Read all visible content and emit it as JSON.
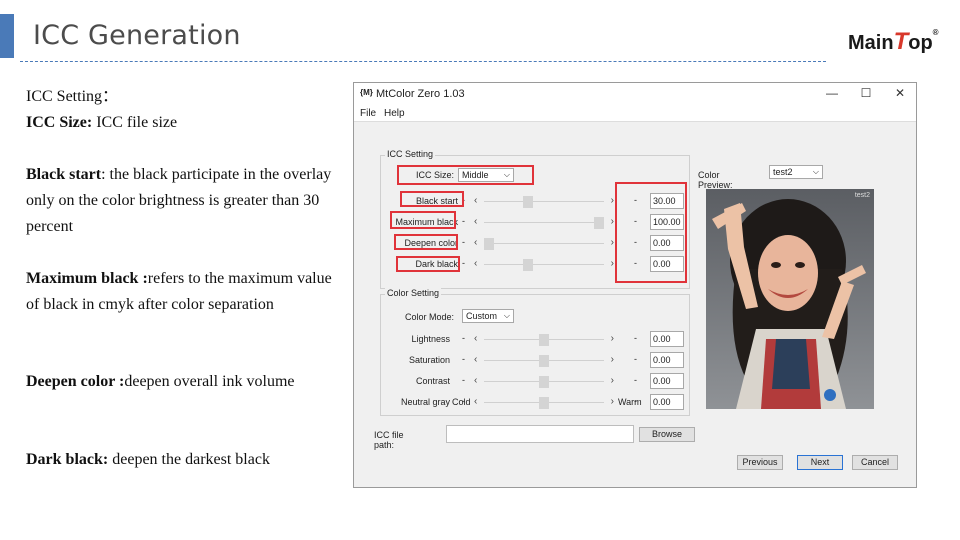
{
  "slide": {
    "title": "ICC Generation",
    "logo_left": "Main",
    "logo_t": "T",
    "logo_right": "op",
    "logo_reg": "®"
  },
  "description": {
    "setting_title": "ICC Setting：",
    "size_term": "ICC Size:",
    "size_text": " ICC file size",
    "black_start_term": "Black start",
    "black_start_text": ": the black participate in the overlay only on the color brightness is greater than 30 percent",
    "max_black_term": "Maximum black :",
    "max_black_text": "refers to the maximum value of black in cmyk after color separation",
    "deepen_term": "Deepen color :",
    "deepen_text": "deepen overall ink volume",
    "dark_term": "Dark black:",
    "dark_text": " deepen the darkest black"
  },
  "dialog": {
    "app_icon": "{M}",
    "title": "MtColor Zero 1.03",
    "menu": [
      "File",
      "Help"
    ],
    "icc_group_label": "ICC Setting",
    "icc_size_label": "ICC Size:",
    "icc_size_value": "Middle",
    "sliders": [
      {
        "label": "Black start",
        "value": "30.00",
        "level": 0.35
      },
      {
        "label": "Maximum black",
        "value": "100.00",
        "level": 1.0
      },
      {
        "label": "Deepen color",
        "value": "0.00",
        "level": 0.0
      },
      {
        "label": "Dark black",
        "value": "0.00",
        "level": 0.35
      }
    ],
    "color_group_label": "Color Setting",
    "color_mode_label": "Color Mode:",
    "color_mode_value": "Custom",
    "color_sliders": [
      {
        "label": "Lightness",
        "value": "0.00",
        "left": "",
        "right": "",
        "level": 0.5
      },
      {
        "label": "Saturation",
        "value": "0.00",
        "left": "",
        "right": "",
        "level": 0.5
      },
      {
        "label": "Contrast",
        "value": "0.00",
        "left": "",
        "right": "",
        "level": 0.5
      },
      {
        "label": "Neutral gray",
        "value": "0.00",
        "left": "Cold",
        "right": "Warm",
        "level": 0.5
      }
    ],
    "preview_label": "Color Preview:",
    "preview_value": "test2",
    "preview_tag": "test2",
    "path_label": "ICC file path:",
    "browse_label": "Browse",
    "previous_label": "Previous",
    "next_label": "Next",
    "cancel_label": "Cancel"
  },
  "colors": {
    "accent": "#4a7ab8",
    "highlight": "#e0333a",
    "logo_red": "#d8382b"
  }
}
